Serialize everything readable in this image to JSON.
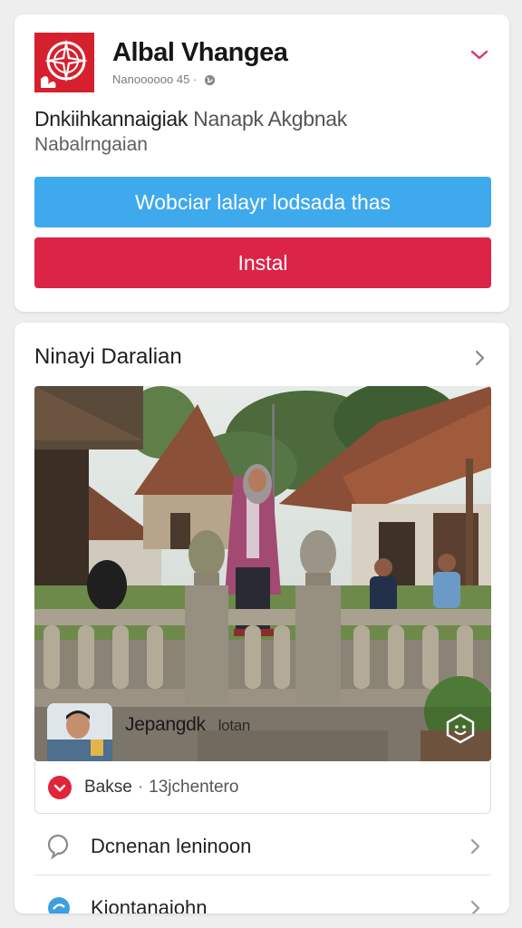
{
  "app": {
    "title": "Albal Vhangea",
    "subtitle": "Nanoooooo 45 ·",
    "description_main": "Dnkiihkannaigiak",
    "description_muted": " Nanapk Akgbnak",
    "description_second": "Nabalrngaian",
    "primary_button": "Wobciar lalayr lodsada thas",
    "install_button": "Instal",
    "colors": {
      "logo": "#d6202e",
      "primary": "#3fa9ee",
      "install": "#dc2447"
    }
  },
  "post": {
    "title": "Ninayi Daralian",
    "author_name": "Jepangdk",
    "author_meta": "lotan",
    "meta_badge": "Bakse",
    "meta_text": "13jchentero",
    "icons": {
      "collapse": "chevron-down-icon",
      "expand": "chevron-right-icon",
      "react": "smile-icon",
      "badge": "check-badge-icon"
    }
  },
  "list": [
    {
      "label": "Dcnenan leninoon",
      "icon": "comment-icon"
    },
    {
      "label": "Kiontanaiohn",
      "icon": "share-icon"
    }
  ]
}
